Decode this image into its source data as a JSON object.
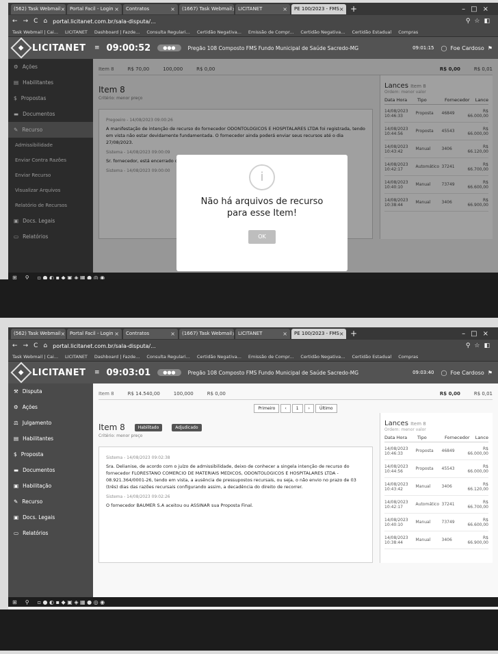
{
  "browser": {
    "tabs": [
      {
        "label": "(562) Task Webmail"
      },
      {
        "label": "Portal Facil - Login"
      },
      {
        "label": "Contratos"
      },
      {
        "label": "(1667) Task Webmail"
      },
      {
        "label": "LICITANET"
      },
      {
        "label": "PE 100/2023 - FMS"
      }
    ],
    "url": "portal.licitanet.com.br/sala-disputa/...",
    "bookmarks": [
      "Task Webmail | Cai...",
      "LICITANET",
      "Dashboard | Fazde...",
      "Consulta Regulari...",
      "Certidão Negativa...",
      "Emissão de Compr...",
      "Certidão Negativa...",
      "Certidão Estadual",
      "Compras"
    ]
  },
  "app": {
    "logo": "LICITANET",
    "logo_sub": "LICITAÇÕES ELETRÔNICAS",
    "process": "Pregão 108 Composto FMS Fundo Municipal de Saúde Sacredo-MG",
    "user": "Foe Cardoso"
  },
  "shot1": {
    "timer": "09:00:52",
    "clock": "09:01:15",
    "sidebar": [
      {
        "label": "Ações",
        "sub": false,
        "active": false
      },
      {
        "label": "Habilitantes",
        "sub": false,
        "active": false
      },
      {
        "label": "Propostas",
        "sub": false,
        "active": false
      },
      {
        "label": "Documentos",
        "sub": false,
        "active": false
      },
      {
        "label": "Recurso",
        "sub": false,
        "active": true
      },
      {
        "label": "Admissibilidade",
        "sub": true,
        "active": false
      },
      {
        "label": "Enviar Contra Razões",
        "sub": true,
        "active": false
      },
      {
        "label": "Enviar Recurso",
        "sub": true,
        "active": false
      },
      {
        "label": "Visualizar Arquivos",
        "sub": true,
        "active": false
      },
      {
        "label": "Relatório de Recursos",
        "sub": true,
        "active": false
      },
      {
        "label": "Docs. Legais",
        "sub": false,
        "active": false
      },
      {
        "label": "Relatórios",
        "sub": false,
        "active": false
      }
    ],
    "toprow": {
      "item": "Item 8",
      "value": "R$ 70,00",
      "qty": "100,000",
      "unit": "R$ 0,00",
      "best": "R$ 0,00",
      "min": "R$ 0,01"
    },
    "item_title": "Item 8",
    "criterio": "Critério: menor preço",
    "messages": [
      {
        "meta": "Pregoeiro - 14/08/2023 09:00:26",
        "text": "A manifestação de intenção de recurso do fornecedor ODONTOLOGICOS E HOSPITALARES LTDA foi registrada, tendo em vista não estar devidamente fundamentada. O fornecedor ainda poderá enviar seus recursos até o dia 27/08/2023."
      },
      {
        "meta": "Sistema - 14/08/2023 09:00:09",
        "text": "Sr. fornecedor, está encerrado o prazo para manifestação de intenção de recurso."
      },
      {
        "meta": "Sistema - 14/08/2023 09:00:00",
        "text": ""
      }
    ],
    "modal": {
      "message": "Não há arquivos de recurso para esse Item!",
      "ok": "OK"
    }
  },
  "shot2": {
    "timer": "09:03:01",
    "clock": "09:03:40",
    "sidebar": [
      {
        "label": "Disputa",
        "sub": false,
        "active": false
      },
      {
        "label": "Ações",
        "sub": false,
        "active": false
      },
      {
        "label": "Julgamento",
        "sub": false,
        "active": false
      },
      {
        "label": "Habilitantes",
        "sub": false,
        "active": false
      },
      {
        "label": "Proposta",
        "sub": false,
        "active": false
      },
      {
        "label": "Documentos",
        "sub": false,
        "active": false
      },
      {
        "label": "Habilitação",
        "sub": false,
        "active": false
      },
      {
        "label": "Recurso",
        "sub": false,
        "active": false
      },
      {
        "label": "Docs. Legais",
        "sub": false,
        "active": false
      },
      {
        "label": "Relatórios",
        "sub": false,
        "active": false
      }
    ],
    "toprow": {
      "item": "Item 8",
      "value": "R$ 14.540,00",
      "qty": "100,000",
      "unit": "R$ 0,00",
      "best": "R$ 0,00",
      "min": "R$ 0,01"
    },
    "pager": [
      "Primeiro",
      "‹",
      "1",
      "›",
      "Último"
    ],
    "item_title": "Item 8",
    "chips": [
      "Habilitado",
      "Adjudicado"
    ],
    "criterio": "Critério: menor preço",
    "messages": [
      {
        "meta": "Sistema - 14/08/2023 09:02:38",
        "text": "Sra. Delianise, de acordo com o juízo de admissibilidade, deixo de conhecer a singela intenção de recurso do fornecedor FLORESTANO COMERCIO DE MATERIAIS MEDICOS, ODONTOLOGICOS E HOSPITALARES LTDA - 08.921.364/0001-26, tendo em vista, a ausência de pressupostos recursais, ou seja, o não envio no prazo de 03 (três) dias das razões recursais configurando assim, a decadência do direito de recorrer."
      },
      {
        "meta": "Sistema - 14/08/2023 09:02:26",
        "text": "O fornecedor BAUMER S.A aceitou ou ASSINAR sua Proposta Final."
      }
    ]
  },
  "lances": {
    "title": "Lances",
    "item": "Item 8",
    "sub": "Ordem: menor valor",
    "headers": [
      "Data Hora",
      "Tipo",
      "Fornecedor",
      "Lance"
    ],
    "rows": [
      {
        "date": "14/08/2023 10:46:33",
        "type": "Proposta",
        "vendor": "46849",
        "value": "R$ 66.000,00"
      },
      {
        "date": "14/08/2023 10:44:56",
        "type": "Proposta",
        "vendor": "45543",
        "value": "R$ 66.000,00"
      },
      {
        "date": "14/08/2023 10:43:42",
        "type": "Manual",
        "vendor": "3406",
        "value": "R$ 66.120,00"
      },
      {
        "date": "14/08/2023 10:42:17",
        "type": "Automático",
        "vendor": "37241",
        "value": "R$ 66.700,00"
      },
      {
        "date": "14/08/2023 10:40:10",
        "type": "Manual",
        "vendor": "73749",
        "value": "R$ 66.600,00"
      },
      {
        "date": "14/08/2023 10:38:44",
        "type": "Manual",
        "vendor": "3406",
        "value": "R$ 66.900,00"
      }
    ]
  }
}
